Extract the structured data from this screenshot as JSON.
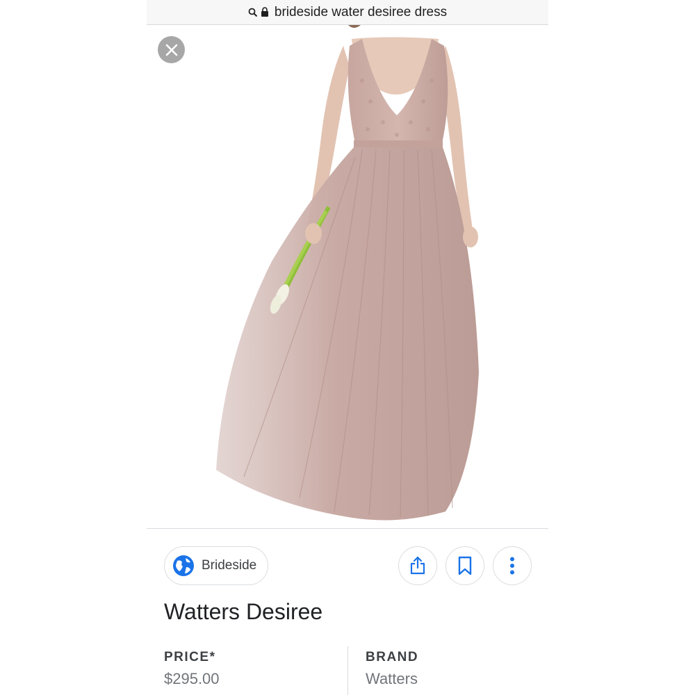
{
  "address_bar": {
    "url_text": "brideside water desiree dress"
  },
  "image_viewer": {
    "close_icon": "close-icon"
  },
  "source": {
    "name": "Brideside",
    "icon": "globe-icon"
  },
  "actions": {
    "share_icon": "share-icon",
    "save_icon": "bookmark-icon",
    "more_icon": "more-vertical-icon"
  },
  "product": {
    "title": "Watters Desiree",
    "price_label": "PRICE*",
    "price_value": "$295.00",
    "brand_label": "BRAND",
    "brand_value": "Watters"
  },
  "colors": {
    "accent": "#1a73e8",
    "dress": "#c9aaa4"
  }
}
